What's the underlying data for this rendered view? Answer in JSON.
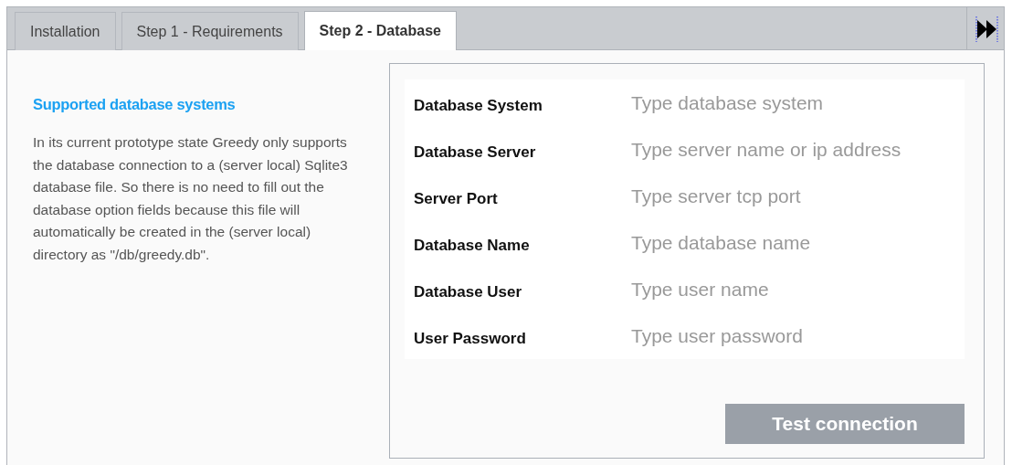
{
  "tabs": [
    {
      "label": "Installation",
      "selected": false
    },
    {
      "label": "Step 1 - Requirements",
      "selected": false
    },
    {
      "label": "Step 2 - Database",
      "selected": true
    }
  ],
  "info": {
    "heading": "Supported database systems",
    "text": "In its current prototype state Greedy only supports the database connection to a (server local) Sqlite3 database file. So there is no need to fill out the database option fields because this file will automatically be created in the (server local) directory as \"/db/greedy.db\"."
  },
  "form": {
    "fields": [
      {
        "label": "Database System",
        "placeholder": "Type database system"
      },
      {
        "label": "Database Server",
        "placeholder": "Type server name or ip address"
      },
      {
        "label": "Server Port",
        "placeholder": "Type server tcp port"
      },
      {
        "label": "Database Name",
        "placeholder": "Type database name"
      },
      {
        "label": "Database User",
        "placeholder": "Type user name"
      },
      {
        "label": "User Password",
        "placeholder": "Type user password"
      }
    ],
    "button": {
      "label": "Test connection",
      "disabled": true
    }
  }
}
